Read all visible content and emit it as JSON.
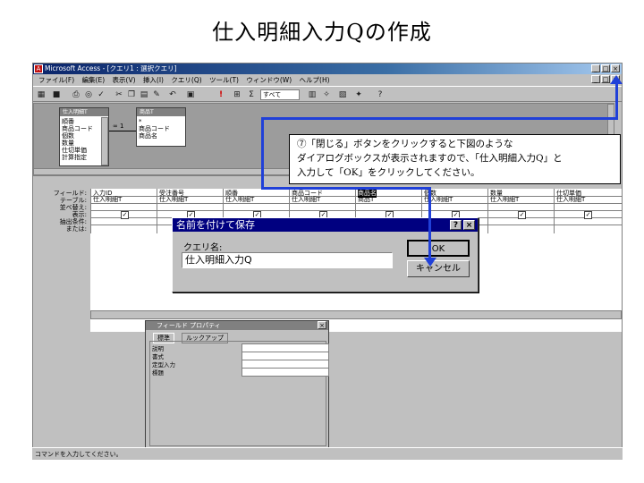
{
  "slide": {
    "title": "仕入明細入力Qの作成"
  },
  "window": {
    "title": "Microsoft Access - [クエリ1 : 選択クエリ]",
    "menu": [
      "ファイル(F)",
      "編集(E)",
      "表示(V)",
      "挿入(I)",
      "クエリ(Q)",
      "ツール(T)",
      "ウィンドウ(W)",
      "ヘルプ(H)"
    ],
    "toolbar_combo": "すべて",
    "status": "コマンドを入力してください。"
  },
  "tables": {
    "t1": {
      "title": "仕入明細T",
      "fields": "順番\n商品コード\n個数\n数量\n仕切単価\n計算指定"
    },
    "t2": {
      "title": "商品T",
      "fields": "*\n商品コード\n商品名"
    },
    "join_label": "∞ 1"
  },
  "grid": {
    "row_labels": [
      "フィールド:",
      "テーブル:",
      "並べ替え:",
      "表示:",
      "抽出条件:",
      "または:"
    ],
    "columns": [
      {
        "field": "入力ID",
        "table": "仕入明細T"
      },
      {
        "field": "受注番号",
        "table": "仕入明細T"
      },
      {
        "field": "順番",
        "table": "仕入明細T"
      },
      {
        "field": "商品コード",
        "table": "仕入明細T"
      },
      {
        "field": "商品名",
        "table": "商品T"
      },
      {
        "field": "個数",
        "table": "仕入明細T"
      },
      {
        "field": "数量",
        "table": "仕入明細T"
      },
      {
        "field": "仕切単価",
        "table": "仕入明細T"
      }
    ]
  },
  "dialog": {
    "title": "名前を付けて保存",
    "label": "クエリ名:",
    "value": "仕入明細入力Q",
    "ok": "OK",
    "cancel": "キャンセル",
    "help": "?",
    "close": "×"
  },
  "properties": {
    "title": "フィールド プロパティ",
    "tabs": [
      "標準",
      "ルックアップ"
    ],
    "rows": [
      "説明",
      "書式",
      "定型入力",
      "標題"
    ]
  },
  "annotation": {
    "line1": "⑦「閉じる」ボタンをクリックすると下図のような",
    "line2": "ダイアログボックスが表示されますので、「仕入明細入力Q」と",
    "line3": "入力して「OK」をクリックしてください。"
  },
  "colors": {
    "annotation": "#2040d8",
    "titlebar": "#000080"
  }
}
